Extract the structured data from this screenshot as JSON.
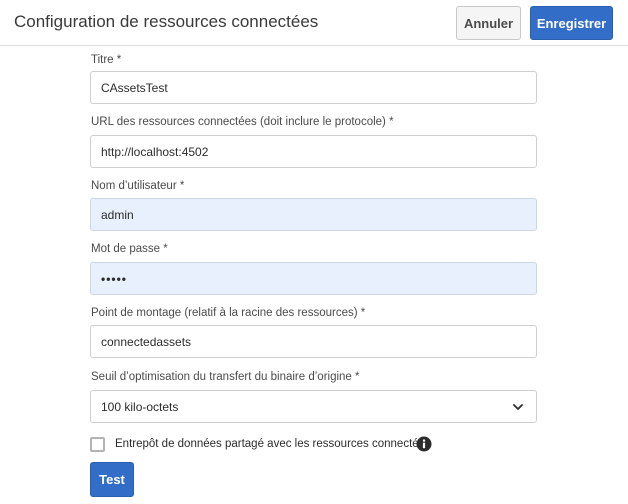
{
  "header": {
    "title": "Configuration de ressources connectées",
    "cancel_label": "Annuler",
    "save_label": "Enregistrer"
  },
  "form": {
    "title": {
      "label": "Titre *",
      "value": "CAssetsTest"
    },
    "url": {
      "label": "URL des ressources connectées (doit inclure le protocole) *",
      "value": "http://localhost:4502"
    },
    "username": {
      "label": "Nom d’utilisateur *",
      "value": "admin"
    },
    "password": {
      "label": "Mot de passe *",
      "value": "•••••"
    },
    "mount_point": {
      "label": "Point de montage (relatif à la racine des ressources) *",
      "value": "connectedassets"
    },
    "threshold": {
      "label": "Seuil d’optimisation du transfert du binaire d’origine *",
      "selected": "100 kilo-octets"
    },
    "shared_datastore": {
      "label": "Entrepôt de données partagé avec les ressources connectées",
      "checked": false
    },
    "test_label": "Test"
  },
  "icons": {
    "select": "chevron-down-icon",
    "info": "info-icon"
  },
  "colors": {
    "primary": "#326ec8",
    "autofill": "#e8f0fe"
  }
}
